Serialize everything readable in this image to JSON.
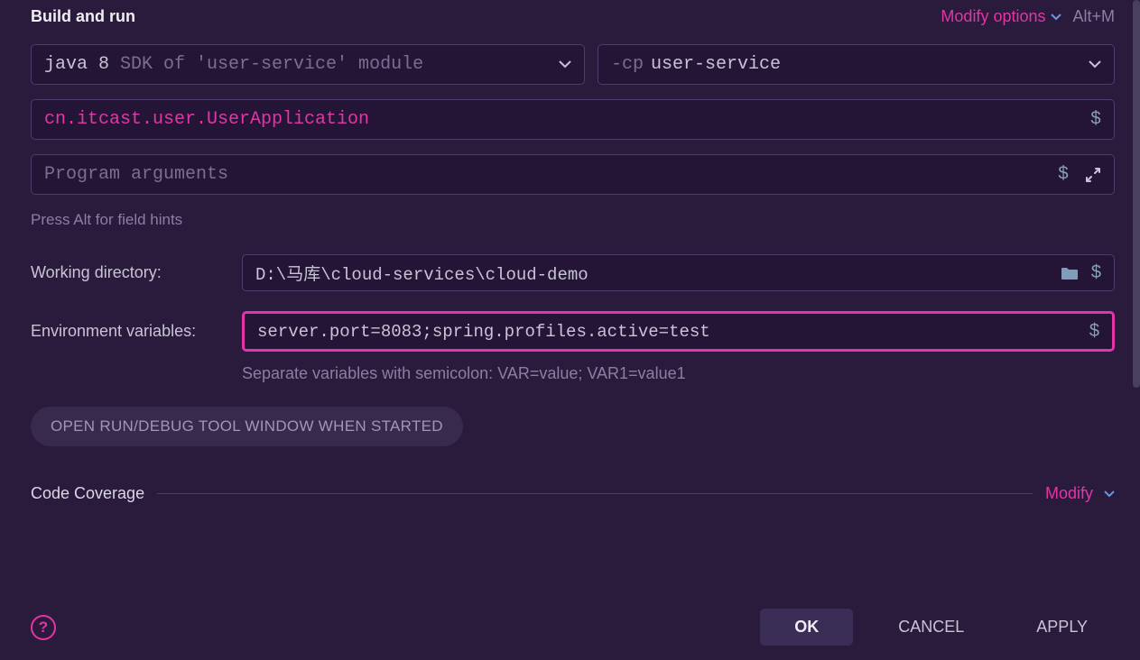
{
  "header": {
    "title": "Build and run",
    "modify_link": "Modify options",
    "shortcut": "Alt+M"
  },
  "jdk": {
    "main": "java 8",
    "hint": " SDK of 'user-service' module"
  },
  "classpath": {
    "prefix": "-cp",
    "value": "user-service"
  },
  "main_class": "cn.itcast.user.UserApplication",
  "program_args": {
    "placeholder": "Program arguments"
  },
  "field_hint": "Press Alt for field hints",
  "working_dir": {
    "label": "Working directory:",
    "value": "D:\\马库\\cloud-services\\cloud-demo"
  },
  "env_vars": {
    "label": "Environment variables:",
    "value": "server.port=8083;spring.profiles.active=test",
    "helper": "Separate variables with semicolon: VAR=value; VAR1=value1"
  },
  "pill": {
    "label": "OPEN RUN/DEBUG TOOL WINDOW WHEN STARTED"
  },
  "coverage": {
    "title": "Code Coverage",
    "modify": "Modify"
  },
  "footer": {
    "ok": "OK",
    "cancel": "CANCEL",
    "apply": "APPLY"
  }
}
